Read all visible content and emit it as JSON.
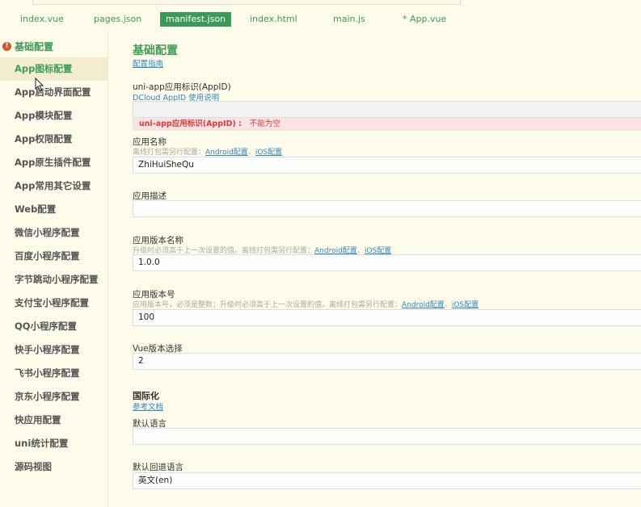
{
  "tabs": [
    {
      "label": "index.vue"
    },
    {
      "label": "pages.json"
    },
    {
      "label": "manifest.json"
    },
    {
      "label": "index.html"
    },
    {
      "label": "main.js"
    },
    {
      "label": "* App.vue"
    }
  ],
  "sidebar": {
    "header": "基础配置",
    "items": [
      {
        "label": "App图标配置"
      },
      {
        "label": "App启动界面配置"
      },
      {
        "label": "App模块配置"
      },
      {
        "label": "App权限配置"
      },
      {
        "label": "App原生插件配置"
      },
      {
        "label": "App常用其它设置"
      },
      {
        "label": "Web配置"
      },
      {
        "label": "微信小程序配置"
      },
      {
        "label": "百度小程序配置"
      },
      {
        "label": "字节跳动小程序配置"
      },
      {
        "label": "支付宝小程序配置"
      },
      {
        "label": "QQ小程序配置"
      },
      {
        "label": "快手小程序配置"
      },
      {
        "label": "飞书小程序配置"
      },
      {
        "label": "京东小程序配置"
      },
      {
        "label": "快应用配置"
      },
      {
        "label": "uni统计配置"
      },
      {
        "label": "源码视图"
      }
    ]
  },
  "main": {
    "title": "基础配置",
    "guide_link": "配置指南",
    "appid": {
      "label": "uni-app应用标识(AppID)",
      "help_link": "DCloud AppID 使用说明",
      "value": "",
      "error_key": "uni-app应用标识(AppID) :",
      "error_msg": "不能为空"
    },
    "app_name": {
      "label": "应用名称",
      "hint": "离线打包需另行配置：",
      "android_link": "Android配置",
      "sep": "、",
      "ios_link": "iOS配置",
      "value": "ZhiHuiSheQu"
    },
    "app_desc": {
      "label": "应用描述",
      "value": ""
    },
    "version_name": {
      "label": "应用版本名称",
      "hint": "升级时必须高于上一次设置的值。离线打包需另行配置：",
      "android_link": "Android配置",
      "sep": "、",
      "ios_link": "iOS配置",
      "value": "1.0.0"
    },
    "version_code": {
      "label": "应用版本号",
      "hint": "应用版本号，必须是整数；升级时必须高于上一次设置的值。离线打包需另行配置：",
      "android_link": "Android配置",
      "sep": "、",
      "ios_link": "iOS配置",
      "value": "100"
    },
    "vue_version": {
      "label": "Vue版本选择",
      "value": "2"
    },
    "i18n": {
      "title": "国际化",
      "doc_link": "参考文档",
      "default_lang_label": "默认语言",
      "default_lang_value": "",
      "fallback_label": "默认回退语言",
      "fallback_value": "英文(en)"
    }
  },
  "colors": {
    "accent_green": "#3f9b56",
    "link_blue": "#2f87c9",
    "error_red": "#d63c3c",
    "error_bg": "#fde4e4",
    "background": "#fdfbe9"
  }
}
